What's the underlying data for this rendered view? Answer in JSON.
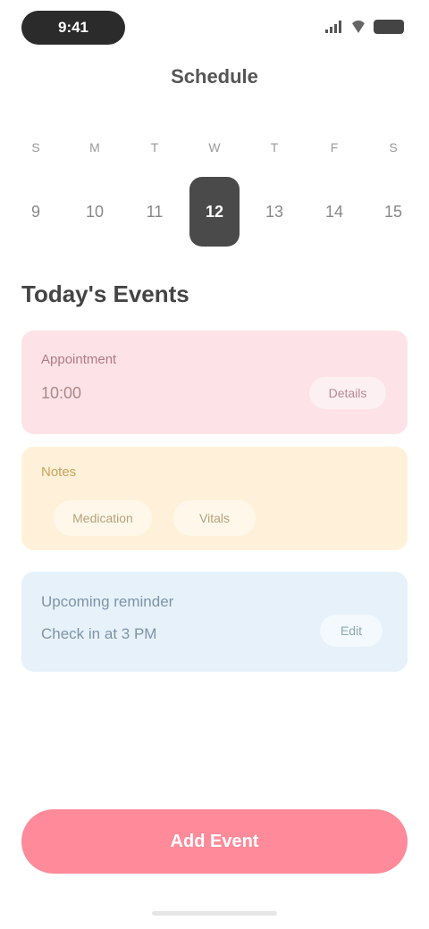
{
  "status_bar": {
    "pill_text": "9:41"
  },
  "header": {
    "title": "Schedule"
  },
  "week": [
    {
      "dow": "S",
      "num": "9"
    },
    {
      "dow": "M",
      "num": "10"
    },
    {
      "dow": "T",
      "num": "11"
    },
    {
      "dow": "W",
      "num": "12",
      "selected": true
    },
    {
      "dow": "T",
      "num": "13"
    },
    {
      "dow": "F",
      "num": "14"
    },
    {
      "dow": "S",
      "num": "15"
    }
  ],
  "section": {
    "title": "Today's Events"
  },
  "cards": {
    "pink": {
      "label": "Appointment",
      "value": "10:00",
      "action": "Details"
    },
    "yellow": {
      "label": "Notes",
      "chip1": "Medication",
      "chip2": "Vitals"
    },
    "blue": {
      "line1": "Upcoming reminder",
      "line2": "Check in at 3 PM",
      "action": "Edit"
    }
  },
  "primary_button": {
    "label": "Add Event"
  }
}
